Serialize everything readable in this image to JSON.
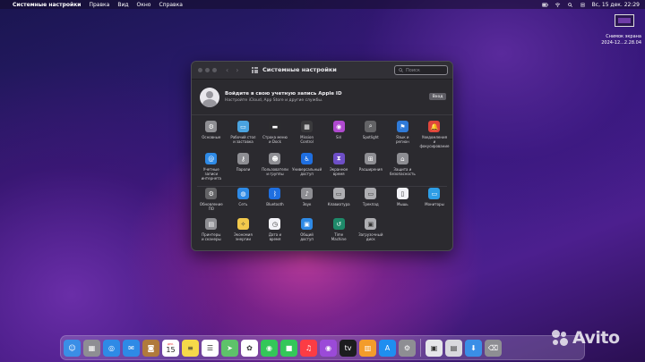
{
  "menubar": {
    "app_name": "Системные настройки",
    "items": [
      "Правка",
      "Вид",
      "Окно",
      "Справка"
    ],
    "datetime": "Вс, 15 дек.  22:29"
  },
  "desktop": {
    "screenshot_label_1": "Снимок экрана",
    "screenshot_label_2": "2024-12...2.28.04"
  },
  "window": {
    "title": "Системные настройки",
    "search_placeholder": "Поиск",
    "apple_id": {
      "title": "Войдите в свою учетную запись Apple ID",
      "subtitle": "Настройте iCloud, App Store и другие службы.",
      "button": "Вход"
    },
    "section1": [
      {
        "label": "Основные",
        "icon": "general-icon",
        "color": "#8e8e93"
      },
      {
        "label": "Рабочий стол\nи заставка",
        "icon": "desktop-icon",
        "color": "#4aa3df"
      },
      {
        "label": "Строка меню\nи Dock",
        "icon": "dock-icon",
        "color": "#2c2c2e"
      },
      {
        "label": "Mission\nControl",
        "icon": "mission-control-icon",
        "color": "#3a3a3c"
      },
      {
        "label": "Siri",
        "icon": "siri-icon",
        "color": "#b04ad0"
      },
      {
        "label": "Spotlight",
        "icon": "spotlight-icon",
        "color": "#636366"
      },
      {
        "label": "Язык и\nрегион",
        "icon": "language-icon",
        "color": "#2f7ad8"
      },
      {
        "label": "Уведомления\nи фокусирование",
        "icon": "notifications-icon",
        "color": "#e0463c"
      },
      {
        "label": "Учетные\nзаписи интернета",
        "icon": "internet-accounts-icon",
        "color": "#2e8ae6"
      },
      {
        "label": "Пароли",
        "icon": "passwords-icon",
        "color": "#8e8e93"
      },
      {
        "label": "Пользователи\nи группы",
        "icon": "users-icon",
        "color": "#8e8e93"
      },
      {
        "label": "Универсальный\nдоступ",
        "icon": "accessibility-icon",
        "color": "#1f6fe0"
      },
      {
        "label": "Экранное\nвремя",
        "icon": "screen-time-icon",
        "color": "#6e4fc7"
      },
      {
        "label": "Расширения",
        "icon": "extensions-icon",
        "color": "#8e8e93"
      },
      {
        "label": "Защита и\nбезопасность",
        "icon": "security-icon",
        "color": "#8e8e93"
      }
    ],
    "section2": [
      {
        "label": "Обновление\nПО",
        "icon": "software-update-icon",
        "color": "#636366"
      },
      {
        "label": "Сеть",
        "icon": "network-icon",
        "color": "#2e8ae6"
      },
      {
        "label": "Bluetooth",
        "icon": "bluetooth-icon",
        "color": "#1f6fe0"
      },
      {
        "label": "Звук",
        "icon": "sound-icon",
        "color": "#8e8e93"
      },
      {
        "label": "Клавиатура",
        "icon": "keyboard-icon",
        "color": "#aeaeb2"
      },
      {
        "label": "Трекпад",
        "icon": "trackpad-icon",
        "color": "#aeaeb2"
      },
      {
        "label": "Мышь",
        "icon": "mouse-icon",
        "color": "#f2f2f7"
      },
      {
        "label": "Мониторы",
        "icon": "displays-icon",
        "color": "#2e9ee6"
      },
      {
        "label": "Принтеры\nи сканеры",
        "icon": "printers-icon",
        "color": "#8e8e93"
      },
      {
        "label": "Экономия\nэнергии",
        "icon": "energy-saver-icon",
        "color": "#f2c94c"
      },
      {
        "label": "Дата и\nвремя",
        "icon": "date-time-icon",
        "color": "#f2f2f7"
      },
      {
        "label": "Общий\nдоступ",
        "icon": "sharing-icon",
        "color": "#2e8ae6"
      },
      {
        "label": "Time\nMachine",
        "icon": "time-machine-icon",
        "color": "#1e8a6a"
      },
      {
        "label": "Загрузочный\nдиск",
        "icon": "startup-disk-icon",
        "color": "#aeaeb2"
      }
    ]
  },
  "dock": {
    "calendar_month": "ДЕК.",
    "calendar_day": "15",
    "apps": [
      {
        "name": "finder-icon",
        "color": "#3a8ee6",
        "glyph": "☺"
      },
      {
        "name": "launchpad-icon",
        "color": "#8e8e93",
        "glyph": "▦"
      },
      {
        "name": "safari-icon",
        "color": "#2e8ae6",
        "glyph": "◎"
      },
      {
        "name": "mail-icon",
        "color": "#2e8ae6",
        "glyph": "✉"
      },
      {
        "name": "contacts-icon",
        "color": "#b07a3c",
        "glyph": "◙"
      },
      {
        "name": "calendar-icon",
        "color": "#ffffff",
        "glyph": ""
      },
      {
        "name": "notes-icon",
        "color": "#f5d94a",
        "glyph": "≡"
      },
      {
        "name": "reminders-icon",
        "color": "#ffffff",
        "glyph": "☰"
      },
      {
        "name": "maps-icon",
        "color": "#5ec26a",
        "glyph": "➤"
      },
      {
        "name": "photos-icon",
        "color": "#ffffff",
        "glyph": "✿"
      },
      {
        "name": "messages-icon",
        "color": "#34c759",
        "glyph": "◉"
      },
      {
        "name": "facetime-icon",
        "color": "#34c759",
        "glyph": "■"
      },
      {
        "name": "music-icon",
        "color": "#fc3c44",
        "glyph": "♫"
      },
      {
        "name": "podcasts-icon",
        "color": "#9b4ad8",
        "glyph": "◉"
      },
      {
        "name": "tv-icon",
        "color": "#1c1c1e",
        "glyph": "tv"
      },
      {
        "name": "books-icon",
        "color": "#f39c2b",
        "glyph": "▥"
      },
      {
        "name": "app-store-icon",
        "color": "#1f8ef0",
        "glyph": "A"
      },
      {
        "name": "system-preferences-icon",
        "color": "#8e8e93",
        "glyph": "⚙"
      }
    ],
    "right_apps": [
      {
        "name": "preview-icon",
        "color": "#e6e6ea",
        "glyph": "▣"
      },
      {
        "name": "screenshot-app-icon",
        "color": "#d9d9de",
        "glyph": "▤"
      },
      {
        "name": "downloads-folder-icon",
        "color": "#3a8ee6",
        "glyph": "⬇"
      },
      {
        "name": "trash-icon",
        "color": "#8e8e93",
        "glyph": "⌫"
      }
    ]
  },
  "watermark": {
    "text": "Avito"
  }
}
